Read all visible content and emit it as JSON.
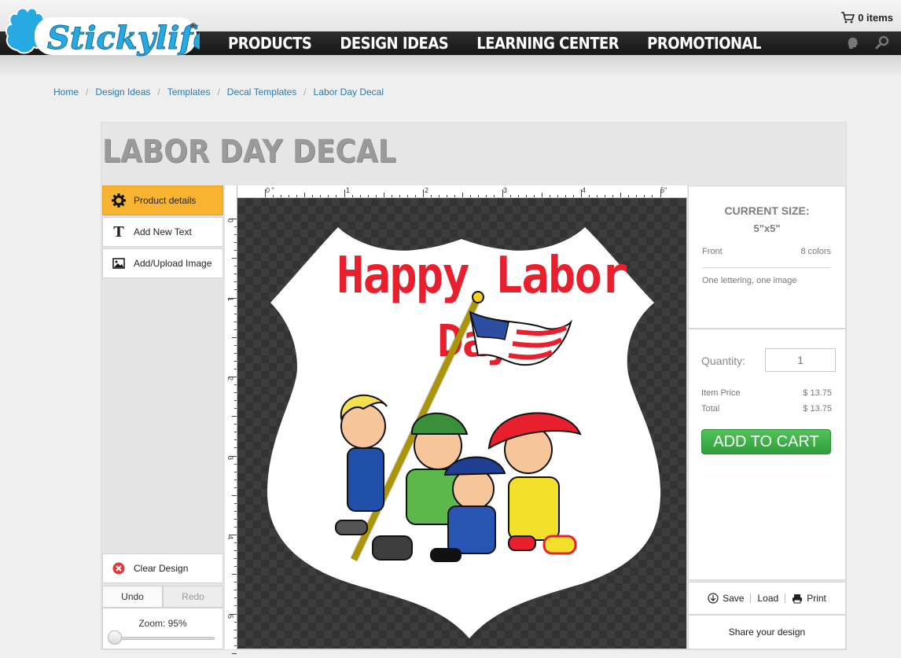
{
  "brand": {
    "name": "Stickylife",
    "mark": "®"
  },
  "header": {
    "cart_count": "0 items",
    "nav": [
      "PRODUCTS",
      "DESIGN IDEAS",
      "LEARNING CENTER",
      "PROMOTIONAL"
    ]
  },
  "breadcrumb": [
    "Home",
    "Design Ideas",
    "Templates",
    "Decal Templates",
    "Labor Day Decal"
  ],
  "page": {
    "title": "LABOR DAY DECAL"
  },
  "tools": {
    "product_details": "Product details",
    "add_text": "Add New Text",
    "add_image": "Add/Upload Image",
    "clear": "Clear Design",
    "undo": "Undo",
    "redo": "Redo",
    "zoom": "Zoom: 95%",
    "zoom_percent": 95
  },
  "ruler": {
    "top": [
      "0 \"",
      "1",
      "2",
      "3",
      "4",
      "5\""
    ],
    "left": [
      "0",
      "1",
      "2",
      "3",
      "4",
      "5"
    ]
  },
  "design": {
    "line1": "Happy Labor",
    "line2": "Day",
    "colors": {
      "text": "#e8202e",
      "shield": "#ffffff",
      "background": "#3d3d3d"
    }
  },
  "summary": {
    "size_title": "CURRENT SIZE:",
    "size_value": "5\"x5\"",
    "side": "Front",
    "colors": "8 colors",
    "content": "One lettering, one image"
  },
  "order": {
    "quantity_label": "Quantity:",
    "quantity": "1",
    "item_price_label": "Item Price",
    "item_price": "$ 13.75",
    "total_label": "Total",
    "total": "$ 13.75",
    "add_to_cart": "ADD TO CART"
  },
  "actions": {
    "save": "Save",
    "load": "Load",
    "print": "Print",
    "share": "Share your design"
  },
  "colors": {
    "accent": "#f8b431",
    "cta": "#3aae47",
    "link": "#2a7ab0"
  }
}
